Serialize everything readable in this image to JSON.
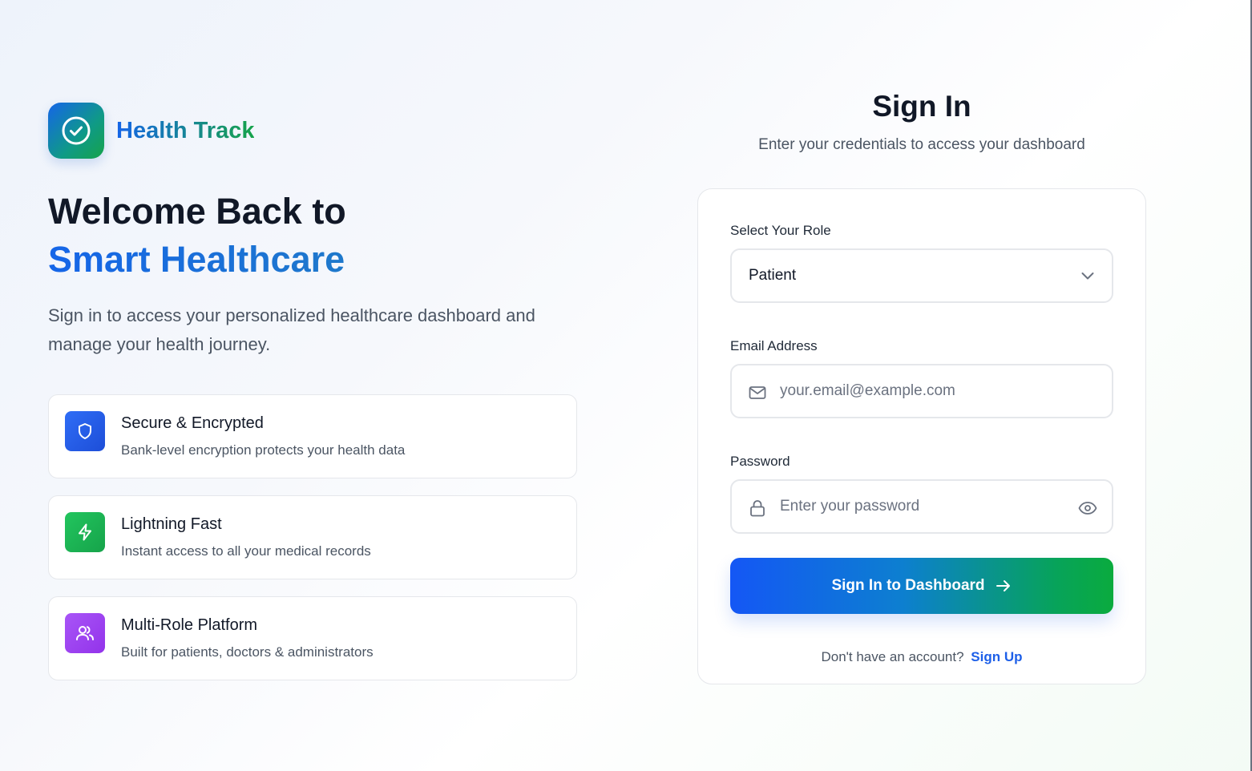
{
  "brand": {
    "name": "Health Track",
    "icon": "check-circle-icon"
  },
  "hero": {
    "line1": "Welcome Back to",
    "line2": "Smart Healthcare",
    "intro": "Sign in to access your personalized healthcare dashboard and manage your health journey."
  },
  "features": [
    {
      "title": "Secure & Encrypted",
      "desc": "Bank-level encryption protects your health data",
      "icon": "shield-icon",
      "color": "#1d4ed8"
    },
    {
      "title": "Lightning Fast",
      "desc": "Instant access to all your medical records",
      "icon": "lightning-icon",
      "color": "#16a34a"
    },
    {
      "title": "Multi-Role Platform",
      "desc": "Built for patients, doctors & administrators",
      "icon": "users-icon",
      "color": "#9333ea"
    }
  ],
  "signin": {
    "title": "Sign In",
    "subtitle": "Enter your credentials to access your dashboard",
    "role_label": "Select Your Role",
    "role_value": "Patient",
    "email_label": "Email Address",
    "email_placeholder": "your.email@example.com",
    "password_label": "Password",
    "password_placeholder": "Enter your password",
    "submit_label": "Sign In to Dashboard",
    "signup_prompt": "Don't have an account?",
    "signup_link": "Sign Up"
  },
  "colors": {
    "primary": "#1d5fe8",
    "accent_green": "#16a34a"
  }
}
